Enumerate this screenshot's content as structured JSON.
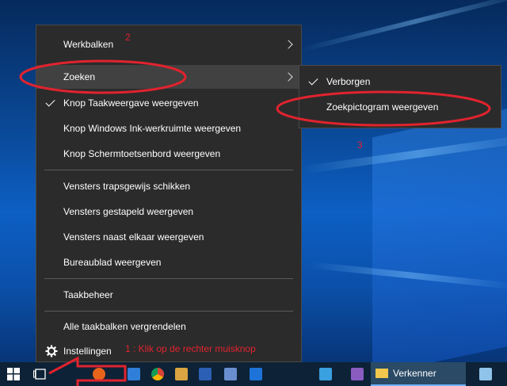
{
  "context_menu": {
    "items": [
      {
        "label": "Werkbalken",
        "submenu": true
      },
      {
        "label": "Zoeken",
        "submenu": true,
        "highlighted": true
      },
      {
        "label": "Knop Taakweergave weergeven",
        "checked": true
      },
      {
        "label": "Knop Windows Ink-werkruimte weergeven"
      },
      {
        "label": "Knop Schermtoetsenbord weergeven"
      },
      {
        "label": "Vensters trapsgewijs schikken"
      },
      {
        "label": "Vensters gestapeld weergeven"
      },
      {
        "label": "Vensters naast elkaar weergeven"
      },
      {
        "label": "Bureaublad weergeven"
      },
      {
        "label": "Taakbeheer"
      },
      {
        "label": "Alle taakbalken vergrendelen"
      },
      {
        "label": "Instellingen",
        "icon": "gear-icon"
      }
    ]
  },
  "submenu": {
    "items": [
      {
        "label": "Verborgen",
        "checked": true
      },
      {
        "label": "Zoekpictogram weergeven"
      }
    ]
  },
  "annotations": {
    "step1": "1 : Klik op de rechter muisknop",
    "step2": "2",
    "step3": "3",
    "color": "#e0232e"
  },
  "taskbar": {
    "active_app": "Verkenner",
    "icons": [
      "windows-start-icon",
      "task-view-icon",
      "firefox-icon",
      "edge-icon",
      "chrome-icon",
      "paint-icon",
      "word-icon",
      "photos-icon",
      "bluetooth-icon",
      "d-app-icon",
      "snipping-icon",
      "file-explorer-icon",
      "notepad-icon"
    ]
  },
  "colors": {
    "menu_bg": "#2b2b2b",
    "menu_highlight": "#414141",
    "taskbar_bg": "#0d2236"
  }
}
